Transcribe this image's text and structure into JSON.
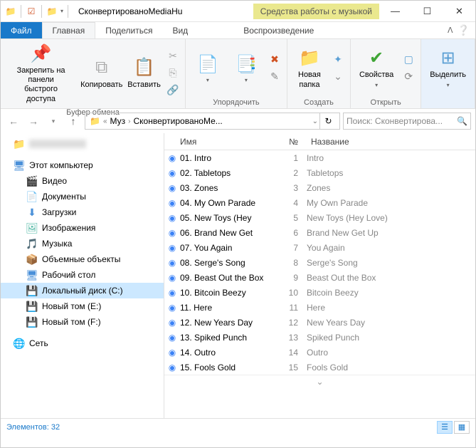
{
  "window": {
    "title": "СконвертированоMediaHu",
    "context_tab": "Средства работы с музыкой",
    "context_subtab": "Воспроизведение"
  },
  "tabs": {
    "file": "Файл",
    "main": "Главная",
    "share": "Поделиться",
    "view": "Вид"
  },
  "ribbon": {
    "pin": "Закрепить на панели\nбыстрого доступа",
    "copy": "Копировать",
    "paste": "Вставить",
    "clipboard_group": "Буфер обмена",
    "organize_group": "Упорядочить",
    "new_folder": "Новая\nпапка",
    "create_group": "Создать",
    "properties": "Свойства",
    "open_group": "Открыть",
    "select": "Выделить"
  },
  "breadcrumb": {
    "seg1": "Муз",
    "seg2": "СконвертированоМе...",
    "search_placeholder": "Поиск: Сконвертирова..."
  },
  "sidebar": {
    "blurred": "",
    "this_pc": "Этот компьютер",
    "videos": "Видео",
    "documents": "Документы",
    "downloads": "Загрузки",
    "pictures": "Изображения",
    "music": "Музыка",
    "objects3d": "Объемные объекты",
    "desktop": "Рабочий стол",
    "local_disk": "Локальный диск (C:)",
    "new_vol_e": "Новый том (E:)",
    "new_vol_f": "Новый том (F:)",
    "network": "Сеть"
  },
  "columns": {
    "name": "Имя",
    "number": "№",
    "title": "Название"
  },
  "files": [
    {
      "name": "01. Intro",
      "num": "1",
      "title": "Intro"
    },
    {
      "name": "02. Tabletops",
      "num": "2",
      "title": "Tabletops"
    },
    {
      "name": "03. Zones",
      "num": "3",
      "title": "Zones"
    },
    {
      "name": "04. My Own Parade",
      "num": "4",
      "title": "My Own Parade"
    },
    {
      "name": "05. New Toys (Hey",
      "num": "5",
      "title": "New Toys (Hey Love)"
    },
    {
      "name": "06. Brand New Get",
      "num": "6",
      "title": "Brand New Get Up"
    },
    {
      "name": "07. You Again",
      "num": "7",
      "title": "You Again"
    },
    {
      "name": "08. Serge's Song",
      "num": "8",
      "title": "Serge's Song"
    },
    {
      "name": "09. Beast Out the Box",
      "num": "9",
      "title": "Beast Out the Box"
    },
    {
      "name": "10. Bitcoin Beezy",
      "num": "10",
      "title": "Bitcoin Beezy"
    },
    {
      "name": "11. Here",
      "num": "11",
      "title": "Here"
    },
    {
      "name": "12. New Years Day",
      "num": "12",
      "title": "New Years Day"
    },
    {
      "name": "13. Spiked Punch",
      "num": "13",
      "title": "Spiked Punch"
    },
    {
      "name": "14. Outro",
      "num": "14",
      "title": "Outro"
    },
    {
      "name": "15. Fools Gold",
      "num": "15",
      "title": "Fools Gold"
    }
  ],
  "status": {
    "count_label": "Элементов:",
    "count": "32"
  }
}
